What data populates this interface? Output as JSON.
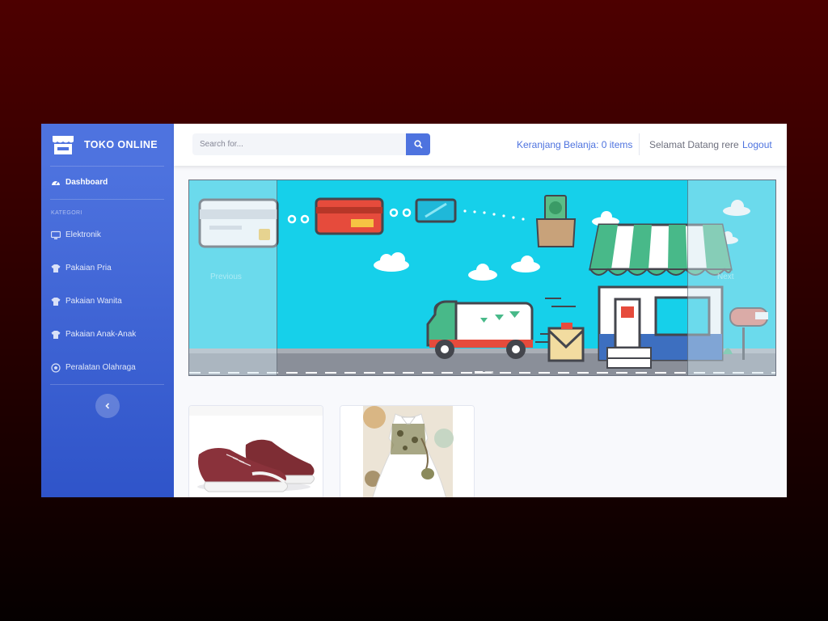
{
  "app": {
    "brand": "TOKO ONLINE"
  },
  "sidebar": {
    "dashboard": "Dashboard",
    "heading": "KATEGORI",
    "items": [
      {
        "label": "Elektronik",
        "icon": "desktop-icon"
      },
      {
        "label": "Pakaian Pria",
        "icon": "tshirt-icon"
      },
      {
        "label": "Pakaian Wanita",
        "icon": "tshirt-icon"
      },
      {
        "label": "Pakaian Anak-Anak",
        "icon": "tshirt-icon"
      },
      {
        "label": "Peralatan Olahraga",
        "icon": "football-icon"
      }
    ],
    "toggle_icon": "chevron-left-icon"
  },
  "topbar": {
    "search_placeholder": "Search for...",
    "cart": "Keranjang Belanja: 0 items",
    "welcome": "Selamat Datang rere",
    "logout": "Logout"
  },
  "carousel": {
    "prev": "Previous",
    "next": "Next",
    "slides": 2,
    "active_slide": 1
  },
  "products": [
    {
      "image": "maroon-sneakers"
    },
    {
      "image": "girls-white-dress"
    }
  ],
  "colors": {
    "primary": "#4e73df",
    "sky": "#16d0ea",
    "background": "#f8f9fc"
  }
}
